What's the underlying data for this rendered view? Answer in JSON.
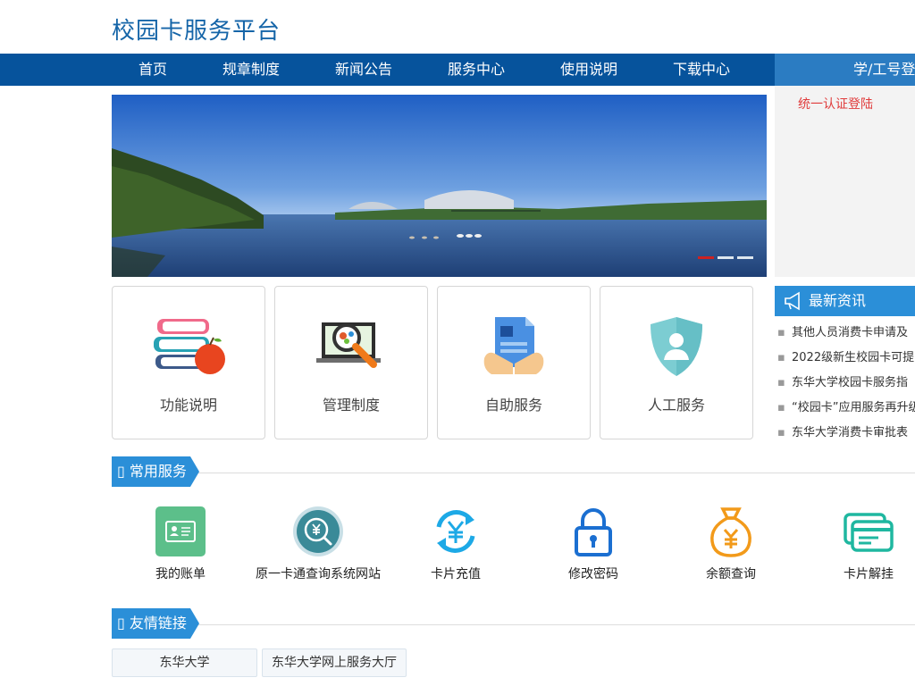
{
  "header": {
    "title": "校园卡服务平台"
  },
  "nav": {
    "items": [
      {
        "label": "首页"
      },
      {
        "label": "规章制度"
      },
      {
        "label": "新闻公告"
      },
      {
        "label": "服务中心"
      },
      {
        "label": "使用说明"
      },
      {
        "label": "下载中心"
      }
    ]
  },
  "login": {
    "tab_label": "学/工号登陆",
    "sso_link": "统一认证登陆"
  },
  "banner": {
    "slides_count": 3,
    "active_slide": 1
  },
  "cards": [
    {
      "label": "功能说明",
      "icon": "books-apple-icon"
    },
    {
      "label": "管理制度",
      "icon": "laptop-magnifier-icon"
    },
    {
      "label": "自助服务",
      "icon": "hand-document-icon"
    },
    {
      "label": "人工服务",
      "icon": "shield-person-icon"
    }
  ],
  "news": {
    "title": "最新资讯",
    "items": [
      {
        "text": "其他人员消费卡申请及"
      },
      {
        "text": "2022级新生校园卡可提"
      },
      {
        "text": "东华大学校园卡服务指"
      },
      {
        "text": "“校园卡”应用服务再升级"
      },
      {
        "text": "东华大学消费卡审批表"
      }
    ]
  },
  "common_services": {
    "title": "常用服务",
    "items": [
      {
        "label": "我的账单",
        "icon": "account-card-icon"
      },
      {
        "label": "原一卡通查询系统网站",
        "icon": "yuan-search-icon"
      },
      {
        "label": "卡片充值",
        "icon": "yuan-refresh-icon"
      },
      {
        "label": "修改密码",
        "icon": "lock-icon"
      },
      {
        "label": "余额查询",
        "icon": "money-bag-icon"
      },
      {
        "label": "卡片解挂",
        "icon": "cards-icon"
      }
    ]
  },
  "friend_links": {
    "title": "友情链接",
    "items": [
      {
        "label": "东华大学"
      },
      {
        "label": "东华大学网上服务大厅"
      }
    ]
  },
  "colors": {
    "nav_bg": "#06539c",
    "accent": "#2b8fd8",
    "title": "#1565a8",
    "login_link": "#e03c3c"
  }
}
